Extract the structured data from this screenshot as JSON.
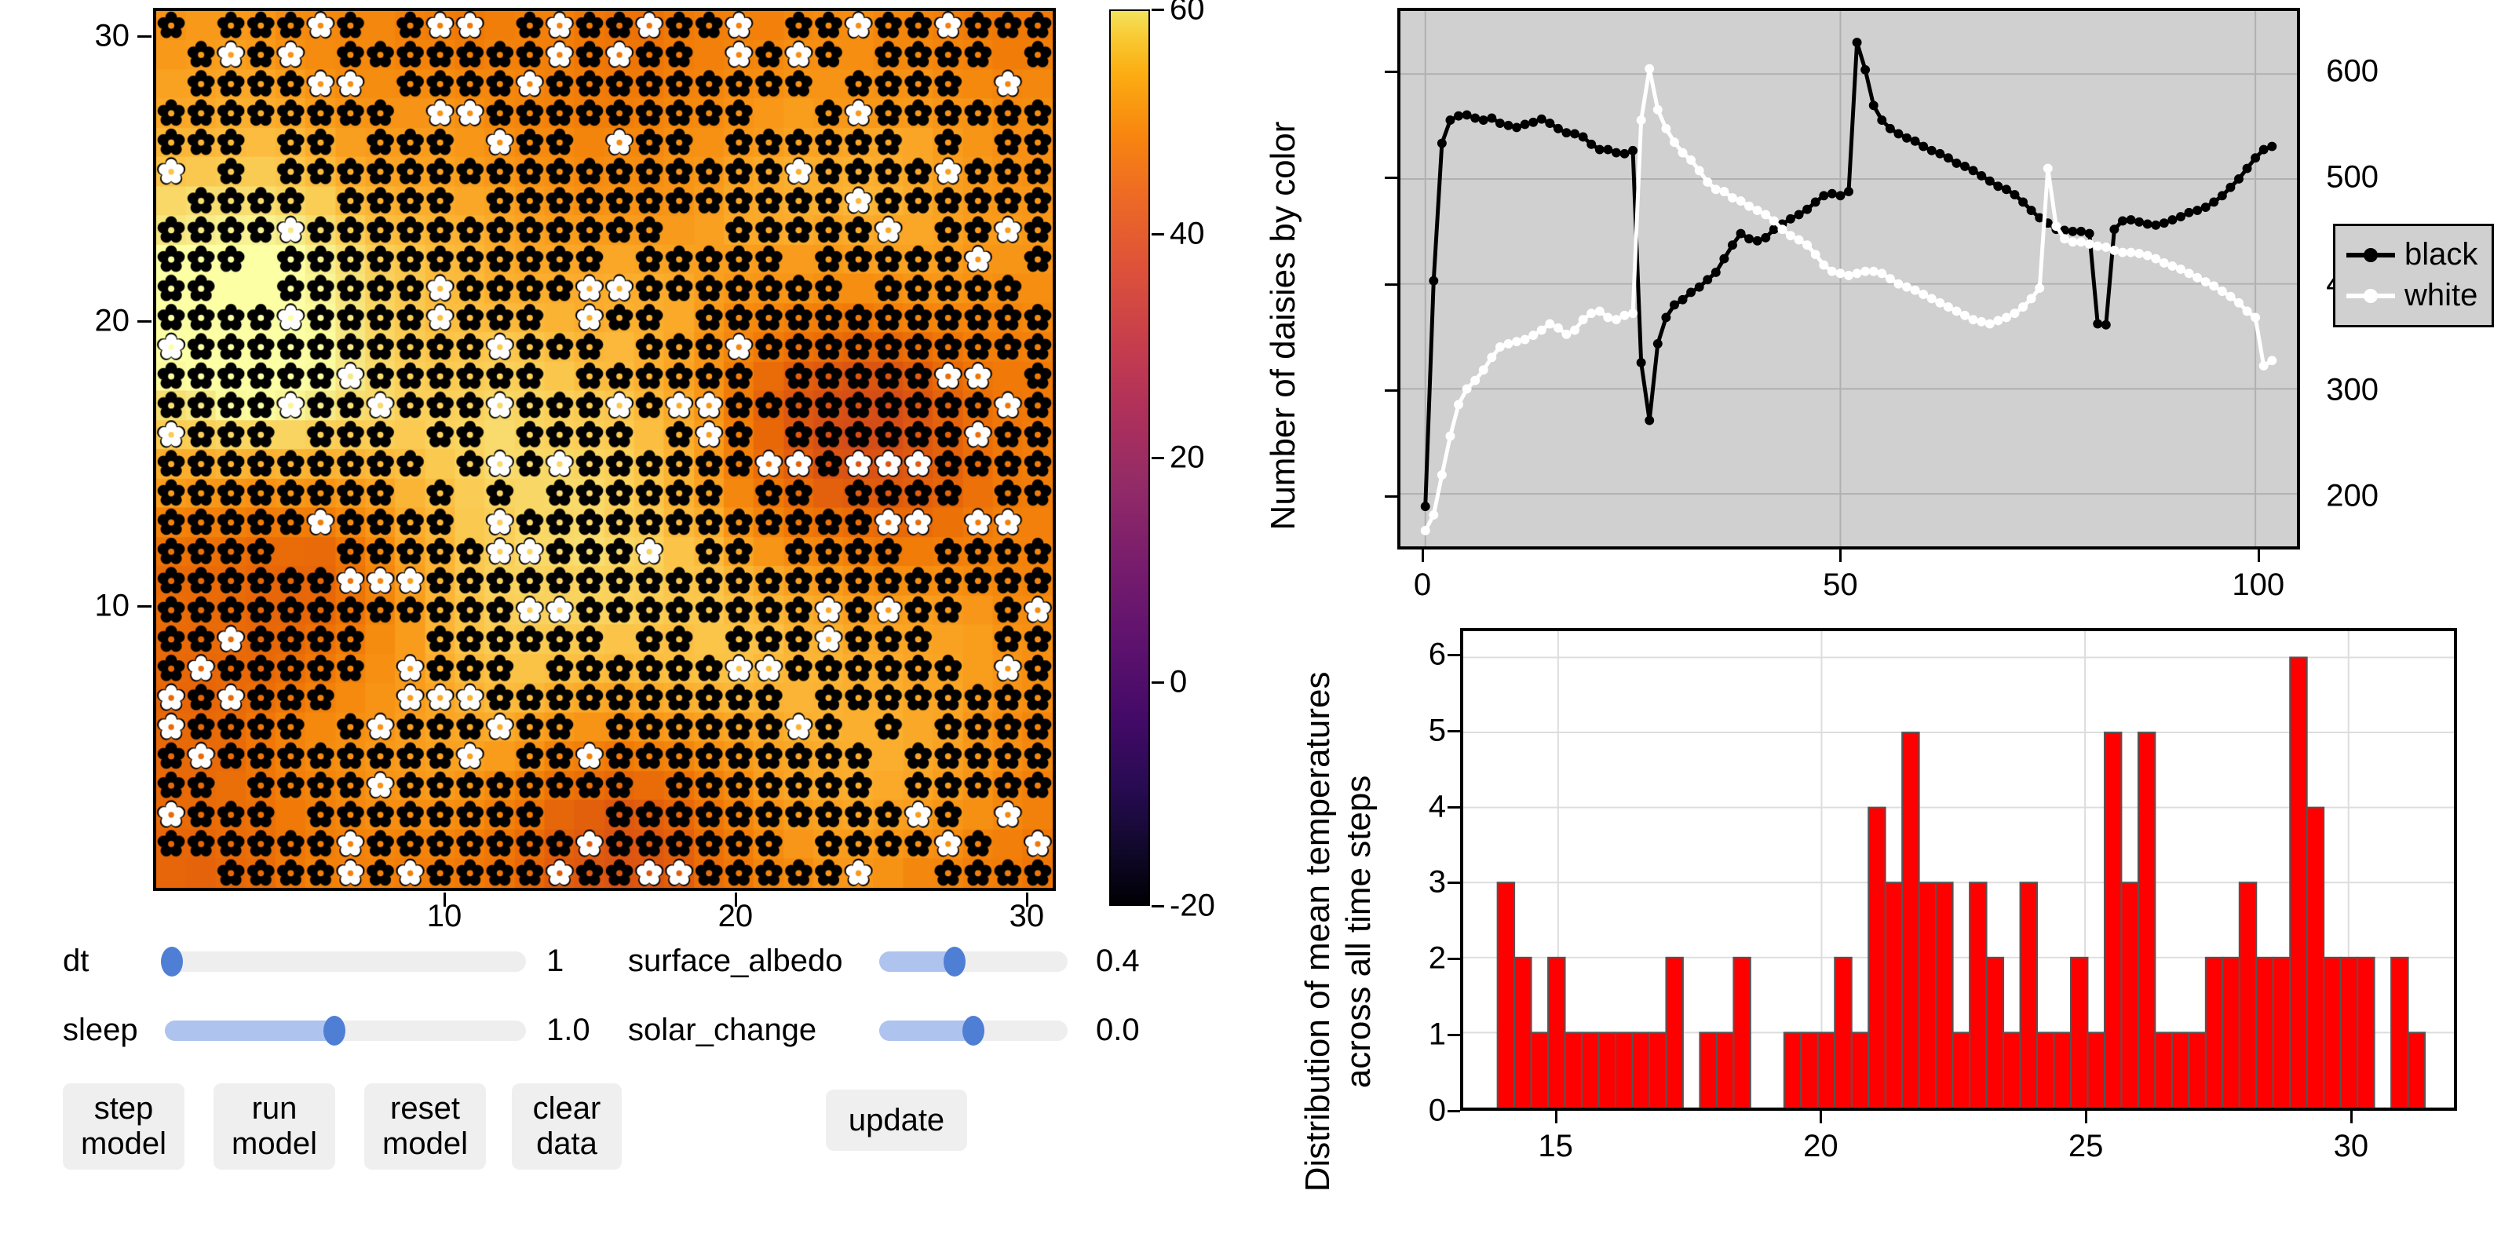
{
  "world": {
    "title": "daisyworld-grid",
    "x_ticks": [
      10,
      20,
      30
    ],
    "y_ticks": [
      10,
      20,
      30
    ],
    "grid_size": 30,
    "axis_min": 0,
    "axis_max": 31
  },
  "colorbar": {
    "name": "temperature-colorbar",
    "colormap": "inferno",
    "ticks": [
      -20,
      0,
      20,
      40,
      60
    ],
    "vmin": -20,
    "vmax": 60
  },
  "controls": {
    "sliders": [
      {
        "name": "dt",
        "label": "dt",
        "value": "1",
        "fill_pct": 2,
        "knob_pct": 2
      },
      {
        "name": "sleep",
        "label": "sleep",
        "value": "1.0",
        "fill_pct": 47,
        "knob_pct": 47
      },
      {
        "name": "surface_albedo",
        "label": "surface_albedo",
        "value": "0.4",
        "fill_pct": 40,
        "knob_pct": 40
      },
      {
        "name": "solar_change",
        "label": "solar_change",
        "value": "0.0",
        "fill_pct": 50,
        "knob_pct": 50
      }
    ],
    "buttons": [
      {
        "name": "step-model",
        "line1": "step",
        "line2": "model"
      },
      {
        "name": "run-model",
        "line1": "run",
        "line2": "model"
      },
      {
        "name": "reset-model",
        "line1": "reset",
        "line2": "model"
      },
      {
        "name": "clear-data",
        "line1": "clear",
        "line2": "data"
      }
    ],
    "update_button": {
      "name": "update",
      "label": "update"
    }
  },
  "chart_data": [
    {
      "type": "line",
      "name": "daisies-by-color-timeseries",
      "title": "",
      "xlabel": "",
      "ylabel": "Number of daisies by color",
      "xlim": [
        -3,
        105
      ],
      "ylim": [
        150,
        660
      ],
      "x_ticks": [
        0,
        50,
        100
      ],
      "y_ticks": [
        200,
        300,
        400,
        500,
        600
      ],
      "grid": true,
      "plot_bg": "#d0d0d0",
      "legend_position": "right-outside",
      "legend": [
        "black",
        "white"
      ],
      "series": [
        {
          "name": "black",
          "color": "#000000",
          "x": [
            0,
            1,
            2,
            3,
            4,
            5,
            6,
            7,
            8,
            9,
            10,
            11,
            12,
            13,
            14,
            15,
            16,
            17,
            18,
            19,
            20,
            21,
            22,
            23,
            24,
            25,
            26,
            27,
            28,
            29,
            30,
            31,
            32,
            33,
            34,
            35,
            36,
            37,
            38,
            39,
            40,
            41,
            42,
            43,
            44,
            45,
            46,
            47,
            48,
            49,
            50,
            51,
            52,
            53,
            54,
            55,
            56,
            57,
            58,
            59,
            60,
            61,
            62,
            63,
            64,
            65,
            66,
            67,
            68,
            69,
            70,
            71,
            72,
            73,
            74,
            75,
            76,
            77,
            78,
            79,
            80,
            81,
            82,
            83,
            84,
            85,
            86,
            87,
            88,
            89,
            90,
            91,
            92,
            93,
            94,
            95,
            96,
            97,
            98,
            99,
            100,
            101,
            102
          ],
          "values": [
            188,
            403,
            534,
            556,
            560,
            561,
            558,
            556,
            558,
            553,
            551,
            549,
            552,
            554,
            557,
            553,
            548,
            544,
            543,
            540,
            533,
            528,
            528,
            525,
            524,
            527,
            325,
            270,
            343,
            368,
            380,
            385,
            392,
            397,
            404,
            411,
            424,
            437,
            448,
            443,
            441,
            444,
            452,
            457,
            462,
            466,
            471,
            478,
            484,
            486,
            484,
            488,
            630,
            604,
            570,
            556,
            548,
            543,
            539,
            536,
            531,
            527,
            524,
            520,
            515,
            512,
            508,
            503,
            498,
            493,
            490,
            485,
            478,
            470,
            463,
            458,
            452,
            451,
            450,
            450,
            448,
            362,
            361,
            452,
            460,
            461,
            459,
            457,
            456,
            458,
            461,
            464,
            468,
            470,
            473,
            478,
            484,
            492,
            500,
            510,
            520,
            528,
            531
          ]
        },
        {
          "name": "white",
          "color": "#ffffff",
          "x": [
            0,
            1,
            2,
            3,
            4,
            5,
            6,
            7,
            8,
            9,
            10,
            11,
            12,
            13,
            14,
            15,
            16,
            17,
            18,
            19,
            20,
            21,
            22,
            23,
            24,
            25,
            26,
            27,
            28,
            29,
            30,
            31,
            32,
            33,
            34,
            35,
            36,
            37,
            38,
            39,
            40,
            41,
            42,
            43,
            44,
            45,
            46,
            47,
            48,
            49,
            50,
            51,
            52,
            53,
            54,
            55,
            56,
            57,
            58,
            59,
            60,
            61,
            62,
            63,
            64,
            65,
            66,
            67,
            68,
            69,
            70,
            71,
            72,
            73,
            74,
            75,
            76,
            77,
            78,
            79,
            80,
            81,
            82,
            83,
            84,
            85,
            86,
            87,
            88,
            89,
            90,
            91,
            92,
            93,
            94,
            95,
            96,
            97,
            98,
            99,
            100,
            101,
            102
          ],
          "values": [
            165,
            180,
            218,
            255,
            285,
            300,
            308,
            318,
            330,
            340,
            343,
            345,
            347,
            351,
            356,
            362,
            358,
            352,
            356,
            366,
            372,
            374,
            368,
            366,
            370,
            372,
            556,
            605,
            566,
            548,
            535,
            525,
            518,
            508,
            497,
            490,
            488,
            482,
            479,
            474,
            470,
            466,
            460,
            452,
            446,
            442,
            437,
            428,
            418,
            412,
            410,
            408,
            410,
            412,
            412,
            410,
            405,
            400,
            397,
            394,
            390,
            386,
            382,
            378,
            374,
            370,
            366,
            364,
            362,
            365,
            368,
            372,
            378,
            386,
            396,
            510,
            455,
            443,
            440,
            440,
            438,
            436,
            435,
            432,
            430,
            430,
            429,
            427,
            424,
            420,
            417,
            414,
            410,
            406,
            402,
            398,
            393,
            388,
            382,
            374,
            368,
            322,
            327
          ]
        }
      ]
    },
    {
      "type": "bar",
      "name": "mean-temperature-histogram",
      "title": "",
      "xlabel": "",
      "ylabel": "Distribution of mean temperatures across all time steps",
      "ylabel_line1": "Distribution of mean temperatures",
      "ylabel_line2": "across all time steps",
      "bar_color": "#ff0000",
      "bar_edge_color": "#555555",
      "grid": true,
      "xlim": [
        13.2,
        32.0
      ],
      "ylim": [
        0,
        6.35
      ],
      "x_ticks": [
        15,
        20,
        25,
        30
      ],
      "y_ticks": [
        0,
        1,
        2,
        3,
        4,
        5,
        6
      ],
      "bin_width": 0.32,
      "bin_starts": [
        13.85,
        14.17,
        14.49,
        14.81,
        15.13,
        15.45,
        15.77,
        16.09,
        16.41,
        16.73,
        17.05,
        17.37,
        17.69,
        18.01,
        18.33,
        18.65,
        18.97,
        19.29,
        19.61,
        19.93,
        20.25,
        20.57,
        20.89,
        21.21,
        21.53,
        21.85,
        22.17,
        22.49,
        22.81,
        23.13,
        23.45,
        23.77,
        24.09,
        24.41,
        24.73,
        25.05,
        25.37,
        25.69,
        26.01,
        26.33,
        26.65,
        26.97,
        27.29,
        27.61,
        27.93,
        28.25,
        28.57,
        28.89,
        29.21,
        29.53,
        29.85,
        30.17,
        30.49,
        30.81,
        31.13,
        31.45
      ],
      "values": [
        3,
        2,
        1,
        2,
        1,
        1,
        1,
        1,
        1,
        1,
        2,
        0,
        1,
        1,
        2,
        0,
        0,
        1,
        1,
        1,
        2,
        1,
        4,
        3,
        5,
        3,
        3,
        1,
        3,
        2,
        1,
        3,
        1,
        1,
        2,
        1,
        5,
        3,
        5,
        1,
        1,
        1,
        2,
        2,
        3,
        2,
        2,
        6,
        4,
        2,
        2,
        2,
        0,
        2,
        1,
        0
      ]
    }
  ]
}
